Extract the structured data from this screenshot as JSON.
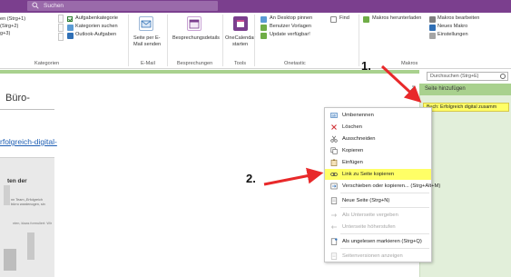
{
  "window": {
    "search_placeholder": "Suchen"
  },
  "ribbon": {
    "left_group": {
      "items": [
        "en (Strg+1)",
        "(Strg+2)",
        "g+3)"
      ],
      "checkboxes": [
        "Aufgabenkategorie",
        "Kategorien suchen",
        "Outlook-Aufgaben"
      ],
      "label": "Kategorien"
    },
    "email": {
      "button": [
        "Seite per E-",
        "Mail senden"
      ],
      "label": "E-Mail"
    },
    "meetings": {
      "button": [
        "Besprechungsdetails"
      ],
      "label": "Besprechungen"
    },
    "tools": {
      "button": [
        "OneCalendar",
        "starten"
      ],
      "label": "Tools"
    },
    "onetastic": {
      "items": [
        "An Desktop pinnen",
        "Benutzer Vorlagen",
        "Update verfügbar!"
      ],
      "label": "Onetastic"
    },
    "find": {
      "label": "Find"
    },
    "macros": {
      "items": [
        "Makros herunterladen"
      ],
      "right_items": [
        "Makros bearbeiten",
        "Neues Makro",
        "Einstellungen"
      ],
      "label": "Makros"
    }
  },
  "page": {
    "title_partial": "Büro-",
    "link_partial": "rfolgreich-digital-",
    "thumb_text": "ten der",
    "thumb_small": [
      "nn Team „Erfolgreich",
      "bürro wardenogen, sin"
    ],
    "thumb_small2": "nten, klaas formuliert: Wir"
  },
  "pages_pane": {
    "search_placeholder": "Durchsuchen (Strg+E)",
    "add_page": "Seite hinzufügen",
    "selected_page": "Buch: Erfolgreich digital zusamm"
  },
  "context_menu": {
    "items": [
      {
        "label": "Umbenennen",
        "icon": "rename-icon",
        "disabled": false,
        "highlighted": false
      },
      {
        "label": "Löschen",
        "icon": "delete-icon",
        "disabled": false,
        "highlighted": false
      },
      {
        "label": "Ausschneiden",
        "icon": "cut-icon",
        "disabled": false,
        "highlighted": false
      },
      {
        "label": "Kopieren",
        "icon": "copy-icon",
        "disabled": false,
        "highlighted": false
      },
      {
        "label": "Einfügen",
        "icon": "paste-icon",
        "disabled": false,
        "highlighted": false
      },
      {
        "label": "Link zu Seite kopieren",
        "icon": "link-icon",
        "disabled": false,
        "highlighted": true
      },
      {
        "label": "Verschieben oder kopieren...  (Strg+Alt+M)",
        "icon": "move-icon",
        "disabled": false,
        "highlighted": false
      },
      {
        "label": "Neue Seite  (Strg+N)",
        "icon": "new-page-icon",
        "disabled": false,
        "highlighted": false
      },
      {
        "label": "Als Unterseite vergeben",
        "icon": "indent-icon",
        "disabled": true,
        "highlighted": false
      },
      {
        "label": "Unterseite höherstufen",
        "icon": "outdent-icon",
        "disabled": true,
        "highlighted": false
      },
      {
        "label": "Als ungelesen markieren  (Strg+Q)",
        "icon": "mark-unread-icon",
        "disabled": false,
        "highlighted": false
      },
      {
        "label": "Seitenversionen anzeigen",
        "icon": "versions-icon",
        "disabled": true,
        "highlighted": false
      }
    ]
  },
  "annotations": {
    "step1": "1.",
    "step2": "2."
  },
  "colors": {
    "brand": "#7b3f8e",
    "highlight": "#ffff66",
    "pane_green": "#a9d18e",
    "arrow_red": "#e8292a"
  }
}
